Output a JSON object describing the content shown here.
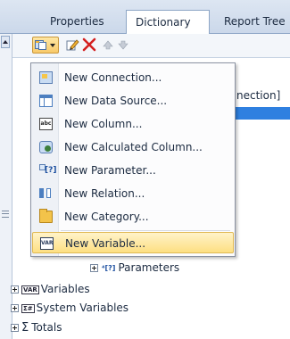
{
  "tabs": [
    {
      "label": "Properties"
    },
    {
      "label": "Dictionary"
    },
    {
      "label": "Report Tree"
    }
  ],
  "toolbar": {
    "new_icon": "new-item-icon",
    "edit_icon": "pencil-icon",
    "delete_icon": "close-icon",
    "move_up_icon": "arrow-up-icon",
    "move_down_icon": "arrow-down-icon"
  },
  "tree": {
    "fragment_text": "nection]",
    "parameters_label": "Parameters",
    "variables_label": "Variables",
    "system_variables_label": "System Variables",
    "totals_label": "Totals",
    "variables_icon_text": "VAR",
    "system_variables_icon_text": "Σ#"
  },
  "menu": {
    "items": [
      {
        "label": "New Connection...",
        "icon": "connection-icon"
      },
      {
        "label": "New Data Source...",
        "icon": "data-source-icon"
      },
      {
        "label": "New Column...",
        "icon": "column-icon",
        "icon_text": "abc"
      },
      {
        "label": "New Calculated Column...",
        "icon": "calculated-column-icon"
      },
      {
        "label": "New Parameter...",
        "icon": "parameter-icon",
        "icon_text": "[?]"
      },
      {
        "label": "New Relation...",
        "icon": "relation-icon"
      },
      {
        "label": "New Category...",
        "icon": "category-icon"
      },
      {
        "label": "New Variable...",
        "icon": "variable-icon",
        "icon_text": "VAR",
        "highlighted": true
      }
    ]
  },
  "colors": {
    "selection": "#2f80e0",
    "highlight_start": "#fff3c9",
    "highlight_end": "#fddf82",
    "delete": "#d42020"
  }
}
